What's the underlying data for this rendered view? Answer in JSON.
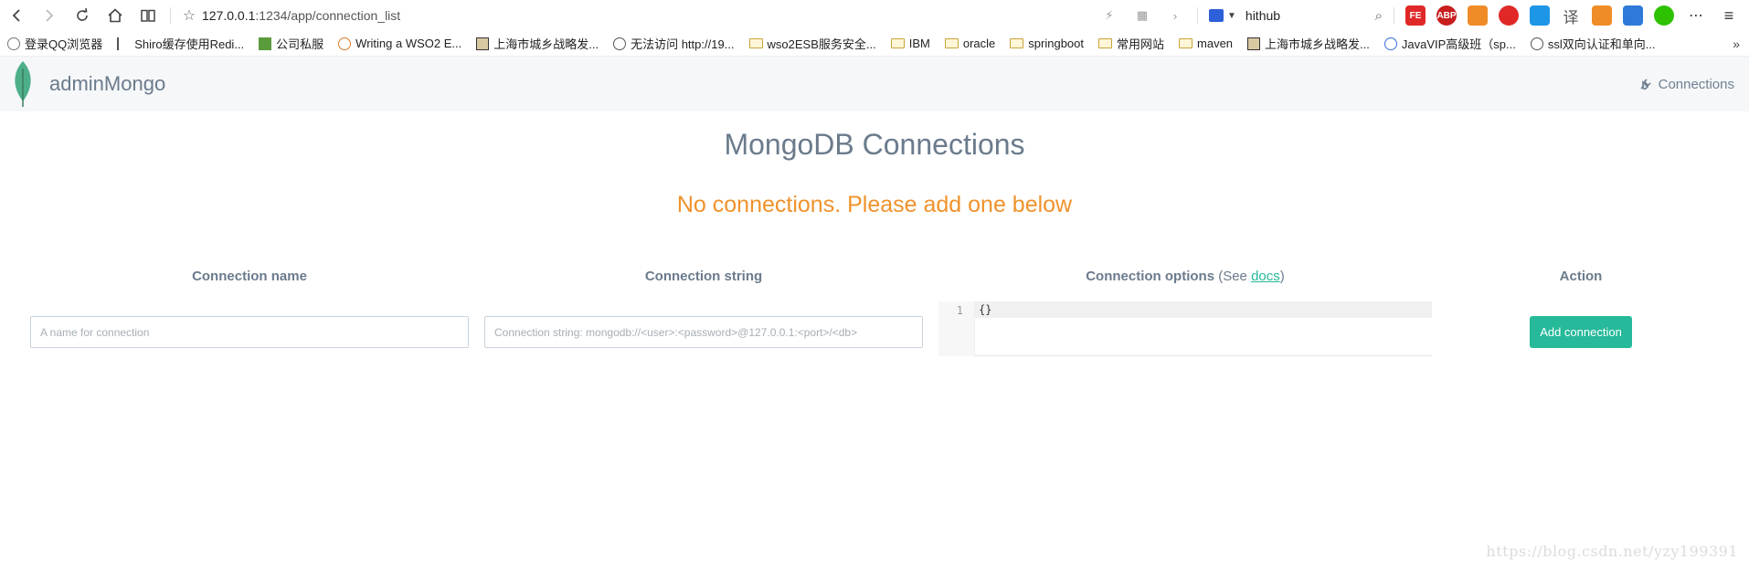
{
  "browser": {
    "url_host": "127.0.0.1",
    "url_path": ":1234/app/connection_list",
    "search_value": "hithub",
    "extensions": [
      {
        "name": "fe-extension-icon",
        "label": "FE",
        "color": "#e02828"
      },
      {
        "name": "adblock-plus-icon",
        "label": "ABP",
        "color": "#c81e1e"
      },
      {
        "name": "game-extension-icon",
        "label": "",
        "color": "#f08c28"
      },
      {
        "name": "opera-extension-icon",
        "label": "",
        "color": "#e02828"
      },
      {
        "name": "play-extension-icon",
        "label": "",
        "color": "#1e96e6"
      },
      {
        "name": "translate-extension-icon",
        "label": "译",
        "color": "#555555"
      },
      {
        "name": "video-extension-icon",
        "label": "",
        "color": "#f08c28"
      },
      {
        "name": "translator-extension-icon",
        "label": "",
        "color": "#2f7ad8"
      },
      {
        "name": "wechat-extension-icon",
        "label": "",
        "color": "#2dc100"
      }
    ]
  },
  "bookmarks": [
    {
      "label": "登录QQ浏览器",
      "icon": "user"
    },
    {
      "label": "Shiro缓存使用Redi...",
      "icon": "s"
    },
    {
      "label": "公司私服",
      "icon": "n"
    },
    {
      "label": "Writing a WSO2 E...",
      "icon": "web"
    },
    {
      "label": "上海市城乡战略发...",
      "icon": "img"
    },
    {
      "label": "无法访问 http://19...",
      "icon": "globe"
    },
    {
      "label": "wso2ESB服务安全...",
      "icon": "folder"
    },
    {
      "label": "IBM",
      "icon": "folder"
    },
    {
      "label": "oracle",
      "icon": "folder"
    },
    {
      "label": "springboot",
      "icon": "folder"
    },
    {
      "label": "常用网站",
      "icon": "folder"
    },
    {
      "label": "maven",
      "icon": "folder"
    },
    {
      "label": "上海市城乡战略发...",
      "icon": "img"
    },
    {
      "label": "JavaVIP高级班（sp...",
      "icon": "cloud"
    },
    {
      "label": "ssl双向认证和单向...",
      "icon": "globe"
    }
  ],
  "app": {
    "brand": "adminMongo",
    "nav_connections": "Connections",
    "title": "MongoDB Connections",
    "notice": "No connections. Please add one below",
    "columns": {
      "name": "Connection name",
      "string": "Connection string",
      "options": "Connection options",
      "options_see": " (See ",
      "options_docs": "docs",
      "options_close": ")",
      "action": "Action"
    },
    "form": {
      "name_placeholder": "A name for connection",
      "string_placeholder": "Connection string: mongodb://<user>:<password>@127.0.0.1:<port>/<db>",
      "options_line_number": "1",
      "options_value": "{}",
      "add_button": "Add connection"
    }
  },
  "watermark": "https://blog.csdn.net/yzy199391"
}
